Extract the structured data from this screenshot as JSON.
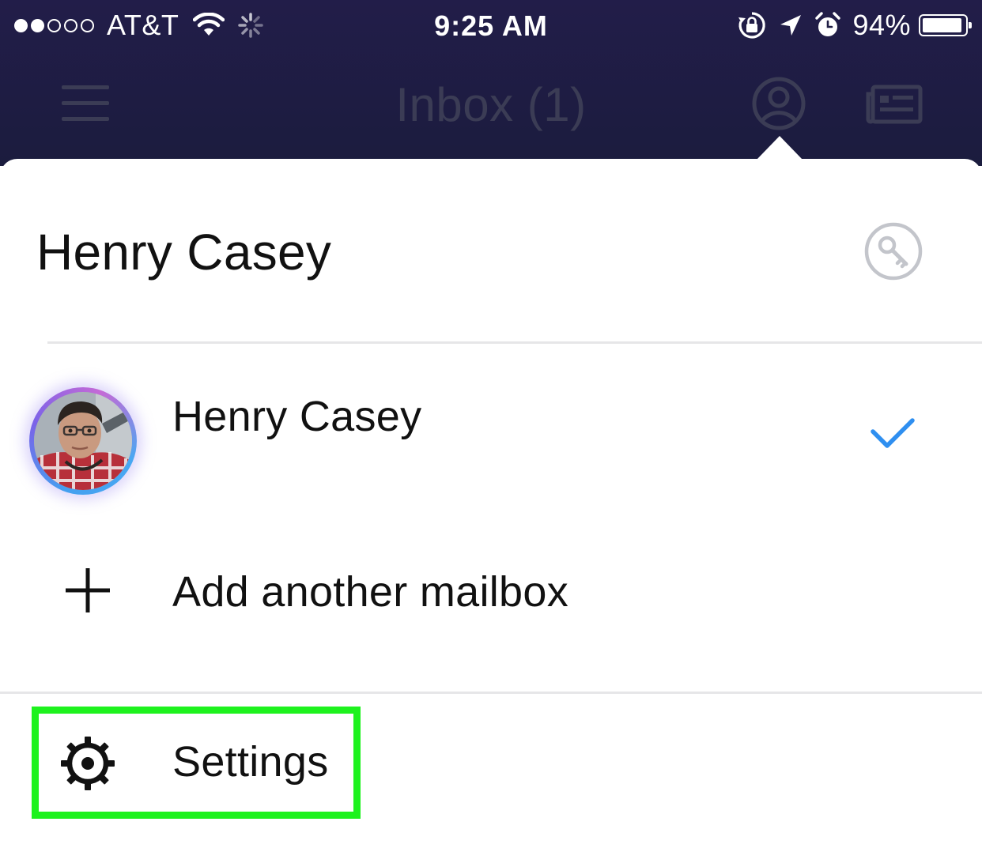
{
  "status_bar": {
    "signal_dots_filled": 2,
    "signal_dots_total": 5,
    "carrier": "AT&T",
    "time": "9:25 AM",
    "battery_percent_label": "94%",
    "battery_level": 0.94,
    "icons": [
      "wifi-icon",
      "loading-spinner-icon",
      "orientation-lock-icon",
      "location-arrow-icon",
      "alarm-icon",
      "battery-icon"
    ]
  },
  "nav_bar": {
    "title": "Inbox (1)",
    "icons": [
      "hamburger-menu-icon",
      "account-icon",
      "compose-card-icon"
    ]
  },
  "account_popover": {
    "header_name": "Henry Casey",
    "key_icon": "key-icon",
    "mailboxes": [
      {
        "name": "Henry Casey",
        "selected": true,
        "avatar": "profile-photo"
      }
    ],
    "add_mailbox_label": "Add another mailbox",
    "settings_label": "Settings"
  },
  "colors": {
    "header_bg": "#1f1d44",
    "checkmark": "#2f8ff0",
    "highlight_box": "#1ef21e",
    "divider": "#e6e6e8",
    "nav_icons": "#3b3c55"
  }
}
